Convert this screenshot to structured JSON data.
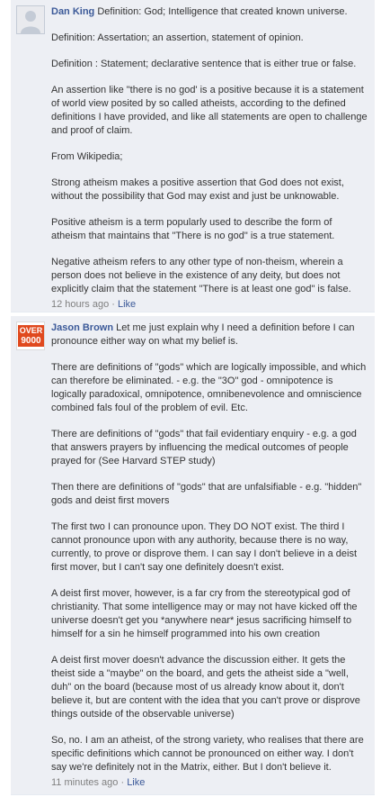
{
  "comments": [
    {
      "author": "Dan King",
      "avatar_icon": "default-profile-silhouette",
      "first_line": "Definition: God; Intelligence that created known universe.",
      "paragraphs": [
        "Definition: Assertation; an assertion, statement of opinion.",
        "Definition : Statement; declarative sentence that is either true or false.",
        "An assertion like \"there is no god' is a positive because it is a statement of world view posited by so called atheists, according to the defined definitions I have provided, and like all statements are open to challenge and proof of claim.",
        "From Wikipedia;",
        "Strong atheism makes a positive assertion that God does not exist, without the possibility that God may exist and just be unknowable.",
        "Positive atheism is a term popularly used to describe the form of atheism that maintains that \"There is no god\" is a true statement.",
        "Negative atheism refers to any other type of non-theism, wherein a person does not believe in the existence of any deity, but does not explicitly claim that the statement \"There is at least one god\" is false."
      ],
      "timestamp": "12 hours ago",
      "separator": " · ",
      "like_label": "Like"
    },
    {
      "author": "Jason Brown",
      "avatar_icon": "over-9000-badge",
      "avatar_text_top": "OVER",
      "avatar_text_bottom": "9000",
      "avatar_color": "#e0491e",
      "first_line": "Let me just explain why I need a definition before I can pronounce either way on what my belief is.",
      "paragraphs": [
        "There are definitions of \"gods\" which are logically impossible, and which can therefore be eliminated. - e.g. the \"3O\" god - omnipotence is logically paradoxical, omnipotence, omnibenevolence and omniscience combined fals foul of the problem of evil. Etc.",
        "There are definitions of \"gods\" that fail evidentiary enquiry - e.g. a god that answers prayers by influencing the medical outcomes of people prayed for (See Harvard STEP study)",
        "Then there are definitions of \"gods\" that are unfalsifiable - e.g. \"hidden\" gods and deist first movers",
        "The first two I can pronounce upon. They DO NOT exist. The third I cannot pronounce upon with any authority, because there is no way, currently, to prove or disprove them. I can say I don't believe in a deist first mover, but I can't say one definitely doesn't exist.",
        "A deist first mover, however, is a far cry from the stereotypical god of christianity. That some intelligence may or may not have kicked off the universe doesn't get you *anywhere near* jesus sacrificing himself to himself for a sin he himself programmed into his own creation",
        "A deist first mover doesn't advance the discussion either. It gets the theist side a \"maybe\" on the board, and gets the atheist side a \"well, duh\" on the board (because most of us already know about it, don't believe it, but are content with the idea that you can't prove or disprove things outside of the observable universe)",
        "So, no. I am an atheist, of the strong variety, who realises that there are specific definitions which cannot be pronounced on either way. I don't say we're definitely not in the Matrix, either. But I don't believe it."
      ],
      "timestamp": "11 minutes ago",
      "separator": " · ",
      "like_label": "Like"
    }
  ],
  "colors": {
    "comment_bg": "#edeff4",
    "link": "#3b5998",
    "timestamp": "#808080"
  }
}
